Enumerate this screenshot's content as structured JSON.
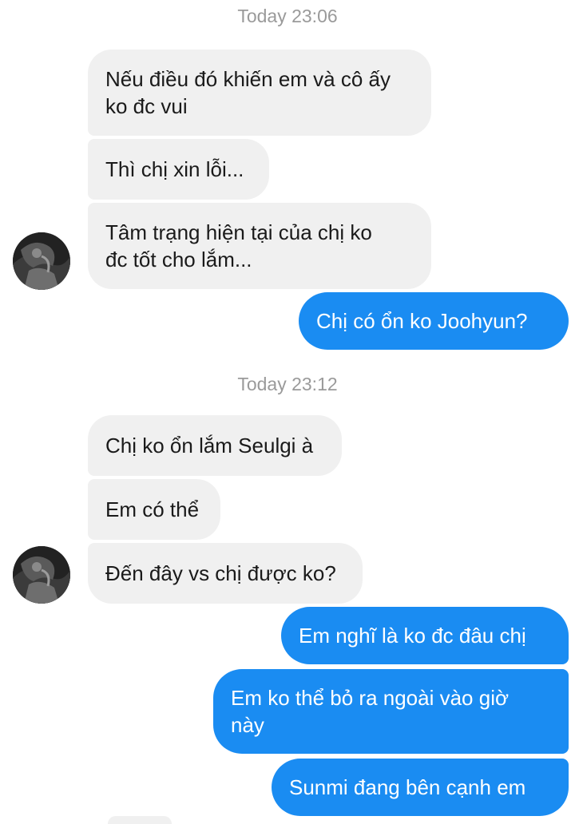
{
  "timestamps": [
    "Today 23:06",
    "Today 23:12"
  ],
  "messages": [
    {
      "text": "Nếu điều đó khiến em và cô ấy\nko đc vui",
      "direction": "incoming"
    },
    {
      "text": "Thì chị xin lỗi...",
      "direction": "incoming"
    },
    {
      "text": "Tâm trạng hiện tại của chị ko\nđc tốt cho lắm...",
      "direction": "incoming"
    },
    {
      "text": "Chị có ổn ko Joohyun?",
      "direction": "outgoing"
    },
    {
      "text": "Chị ko ổn lắm Seulgi à",
      "direction": "incoming"
    },
    {
      "text": "Em có thể",
      "direction": "incoming"
    },
    {
      "text": "Đến đây vs chị được ko?",
      "direction": "incoming"
    },
    {
      "text": "Em nghĩ là ko đc đâu chị",
      "direction": "outgoing"
    },
    {
      "text": "Em ko thể bỏ ra ngoài vào giờ\nnày",
      "direction": "outgoing"
    },
    {
      "text": "Sunmi đang bên cạnh em",
      "direction": "outgoing"
    }
  ],
  "colors": {
    "incoming_bubble": "#f0f0f0",
    "outgoing_bubble": "#1a8cf2",
    "timestamp_text": "#9a9a9a"
  },
  "icons": {
    "avatar": "contact-avatar-photo"
  }
}
